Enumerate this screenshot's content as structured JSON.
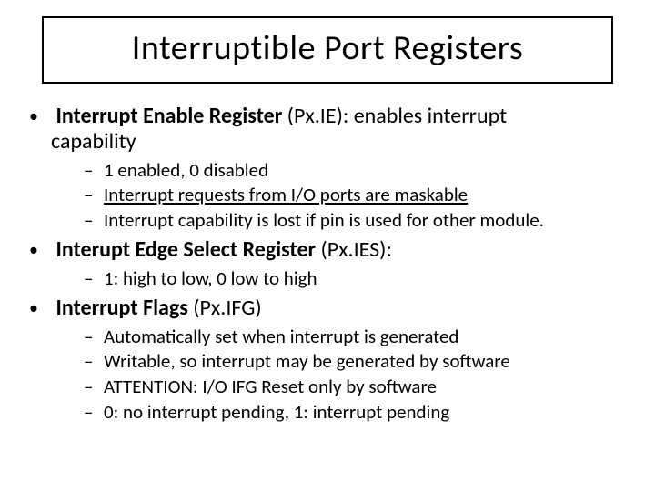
{
  "title": "Interruptible Port Registers",
  "bullets": [
    {
      "strong": "Interrupt Enable Register",
      "after": " (Px.IE):  enables interrupt",
      "cont": "capability",
      "sub": [
        {
          "text": "1 enabled, 0 disabled"
        },
        {
          "text": "Interrupt requests from I/O ports are maskable",
          "underline": true
        },
        {
          "text": "Interrupt capability is lost if  pin is used for other module."
        }
      ]
    },
    {
      "strong": "Interupt Edge Select Register",
      "after": " (Px.IES):",
      "sub": [
        {
          "text": "1:  high to low, 0 low to high"
        }
      ]
    },
    {
      "strong": "Interrupt Flags",
      "after": " (Px.IFG)",
      "sub": [
        {
          "text": "Automatically set when interrupt is generated"
        },
        {
          "text": "Writable, so interrupt may be generated by software"
        },
        {
          "text": "ATTENTION:  I/O  IFG Reset only by software"
        },
        {
          "text": "0:  no interrupt pending,   1:  interrupt pending"
        }
      ]
    }
  ]
}
